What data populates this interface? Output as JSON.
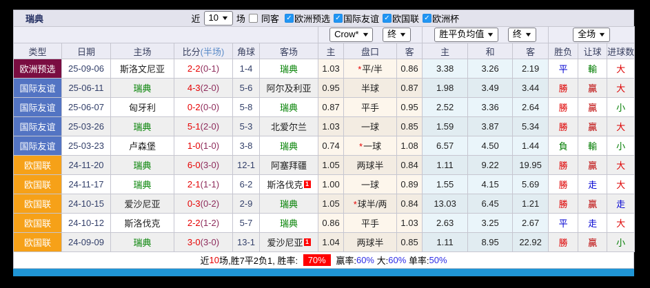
{
  "toolbar": {
    "team": "瑞典",
    "recent_label": "近",
    "recent_value": "10",
    "matches_label": "场",
    "same_away": {
      "label": "同客",
      "checked": false
    },
    "filters": [
      {
        "label": "欧洲预选",
        "checked": true
      },
      {
        "label": "国际友谊",
        "checked": true
      },
      {
        "label": "欧国联",
        "checked": true
      },
      {
        "label": "欧洲杯",
        "checked": true
      }
    ]
  },
  "selectors": {
    "bookmaker": "Crow*",
    "odds_final": "终",
    "avg_label": "胜平负均值",
    "avg_final": "终",
    "scope": "全场"
  },
  "columns": [
    "类型",
    "日期",
    "主场",
    "比分",
    "角球",
    "客场",
    "主",
    "盘口",
    "客",
    "主",
    "和",
    "客",
    "胜负",
    "让球",
    "进球数"
  ],
  "score_half_label": "(半场)",
  "rows": [
    {
      "type": "欧洲预选",
      "type_bg": "type_qual",
      "date": "25-09-06",
      "home": "斯洛文尼亚",
      "home_color": "",
      "home_sup": "",
      "score_ft": "2-2",
      "score_ht": "(0-1)",
      "corners": "1-4",
      "away": "瑞典",
      "away_color": "team_green",
      "away_sup": "",
      "odds_home": "1.03",
      "handicap_star": "*",
      "handicap": "平/半",
      "odds_away": "0.86",
      "avg_home": "3.38",
      "avg_draw": "3.26",
      "avg_away": "2.19",
      "result": "平",
      "result_color": "blue",
      "handicap_result": "輸",
      "handicap_result_color": "green",
      "goals": "大",
      "goals_color": "red"
    },
    {
      "type": "国际友谊",
      "type_bg": "type_friendly",
      "date": "25-06-11",
      "home": "瑞典",
      "home_color": "team_green",
      "home_sup": "",
      "score_ft": "4-3",
      "score_ht": "(2-0)",
      "corners": "5-6",
      "away": "阿尔及利亚",
      "away_color": "",
      "away_sup": "",
      "odds_home": "0.95",
      "handicap_star": "",
      "handicap": "半球",
      "odds_away": "0.87",
      "avg_home": "1.98",
      "avg_draw": "3.49",
      "avg_away": "3.44",
      "result": "勝",
      "result_color": "red",
      "handicap_result": "贏",
      "handicap_result_color": "dark_red",
      "goals": "大",
      "goals_color": "red"
    },
    {
      "type": "国际友谊",
      "type_bg": "type_friendly",
      "date": "25-06-07",
      "home": "匈牙利",
      "home_color": "",
      "home_sup": "",
      "score_ft": "0-2",
      "score_ht": "(0-0)",
      "corners": "5-8",
      "away": "瑞典",
      "away_color": "team_green",
      "away_sup": "",
      "odds_home": "0.87",
      "handicap_star": "",
      "handicap": "平手",
      "odds_away": "0.95",
      "avg_home": "2.52",
      "avg_draw": "3.36",
      "avg_away": "2.64",
      "result": "勝",
      "result_color": "red",
      "handicap_result": "贏",
      "handicap_result_color": "dark_red",
      "goals": "小",
      "goals_color": "green"
    },
    {
      "type": "国际友谊",
      "type_bg": "type_friendly",
      "date": "25-03-26",
      "home": "瑞典",
      "home_color": "team_green",
      "home_sup": "",
      "score_ft": "5-1",
      "score_ht": "(2-0)",
      "corners": "5-3",
      "away": "北爱尔兰",
      "away_color": "",
      "away_sup": "",
      "odds_home": "1.03",
      "handicap_star": "",
      "handicap": "一球",
      "odds_away": "0.85",
      "avg_home": "1.59",
      "avg_draw": "3.87",
      "avg_away": "5.34",
      "result": "勝",
      "result_color": "red",
      "handicap_result": "贏",
      "handicap_result_color": "dark_red",
      "goals": "大",
      "goals_color": "red"
    },
    {
      "type": "国际友谊",
      "type_bg": "type_friendly",
      "date": "25-03-23",
      "home": "卢森堡",
      "home_color": "",
      "home_sup": "",
      "score_ft": "1-0",
      "score_ht": "(1-0)",
      "corners": "3-8",
      "away": "瑞典",
      "away_color": "team_green",
      "away_sup": "",
      "odds_home": "0.74",
      "handicap_star": "*",
      "handicap": "一球",
      "odds_away": "1.08",
      "avg_home": "6.57",
      "avg_draw": "4.50",
      "avg_away": "1.44",
      "result": "負",
      "result_color": "green",
      "handicap_result": "輸",
      "handicap_result_color": "green",
      "goals": "小",
      "goals_color": "green"
    },
    {
      "type": "欧国联",
      "type_bg": "type_nations",
      "date": "24-11-20",
      "home": "瑞典",
      "home_color": "team_green",
      "home_sup": "",
      "score_ft": "6-0",
      "score_ht": "(3-0)",
      "corners": "12-1",
      "away": "阿塞拜疆",
      "away_color": "",
      "away_sup": "",
      "odds_home": "1.05",
      "handicap_star": "",
      "handicap": "两球半",
      "odds_away": "0.84",
      "avg_home": "1.11",
      "avg_draw": "9.22",
      "avg_away": "19.95",
      "result": "勝",
      "result_color": "red",
      "handicap_result": "贏",
      "handicap_result_color": "dark_red",
      "goals": "大",
      "goals_color": "red"
    },
    {
      "type": "欧国联",
      "type_bg": "type_nations",
      "date": "24-11-17",
      "home": "瑞典",
      "home_color": "team_green",
      "home_sup": "",
      "score_ft": "2-1",
      "score_ht": "(1-1)",
      "corners": "6-2",
      "away": "斯洛伐克",
      "away_color": "",
      "away_sup": "1",
      "odds_home": "1.00",
      "handicap_star": "",
      "handicap": "一球",
      "odds_away": "0.89",
      "avg_home": "1.55",
      "avg_draw": "4.15",
      "avg_away": "5.69",
      "result": "勝",
      "result_color": "red",
      "handicap_result": "走",
      "handicap_result_color": "blue",
      "goals": "大",
      "goals_color": "red"
    },
    {
      "type": "欧国联",
      "type_bg": "type_nations",
      "date": "24-10-15",
      "home": "爱沙尼亚",
      "home_color": "",
      "home_sup": "",
      "score_ft": "0-3",
      "score_ht": "(0-2)",
      "corners": "2-9",
      "away": "瑞典",
      "away_color": "team_green",
      "away_sup": "",
      "odds_home": "1.05",
      "handicap_star": "*",
      "handicap": "球半/两",
      "odds_away": "0.84",
      "avg_home": "13.03",
      "avg_draw": "6.45",
      "avg_away": "1.21",
      "result": "勝",
      "result_color": "red",
      "handicap_result": "贏",
      "handicap_result_color": "dark_red",
      "goals": "走",
      "goals_color": "blue"
    },
    {
      "type": "欧国联",
      "type_bg": "type_nations",
      "date": "24-10-12",
      "home": "斯洛伐克",
      "home_color": "",
      "home_sup": "",
      "score_ft": "2-2",
      "score_ht": "(1-2)",
      "corners": "5-7",
      "away": "瑞典",
      "away_color": "team_green",
      "away_sup": "",
      "odds_home": "0.86",
      "handicap_star": "",
      "handicap": "平手",
      "odds_away": "1.03",
      "avg_home": "2.63",
      "avg_draw": "3.25",
      "avg_away": "2.67",
      "result": "平",
      "result_color": "blue",
      "handicap_result": "走",
      "handicap_result_color": "blue",
      "goals": "大",
      "goals_color": "red"
    },
    {
      "type": "欧国联",
      "type_bg": "type_nations",
      "date": "24-09-09",
      "home": "瑞典",
      "home_color": "team_green",
      "home_sup": "",
      "score_ft": "3-0",
      "score_ht": "(3-0)",
      "corners": "13-1",
      "away": "爱沙尼亚",
      "away_color": "",
      "away_sup": "1",
      "odds_home": "1.04",
      "handicap_star": "",
      "handicap": "两球半",
      "odds_away": "0.85",
      "avg_home": "1.11",
      "avg_draw": "8.95",
      "avg_away": "22.92",
      "result": "勝",
      "result_color": "red",
      "handicap_result": "贏",
      "handicap_result_color": "dark_red",
      "goals": "小",
      "goals_color": "green"
    }
  ],
  "summary": {
    "segments": [
      {
        "text": "近",
        "style": "plain"
      },
      {
        "text": "10",
        "style": "red"
      },
      {
        "text": "场,胜7平2负1, 胜率: ",
        "style": "plain"
      },
      {
        "text": "70%",
        "style": "badge"
      },
      {
        "text": " 赢率:",
        "style": "plain"
      },
      {
        "text": "60%",
        "style": "blue"
      },
      {
        "text": " 大:",
        "style": "plain"
      },
      {
        "text": "60%",
        "style": "blue"
      },
      {
        "text": " 单率:",
        "style": "plain"
      },
      {
        "text": "50%",
        "style": "blue"
      }
    ]
  },
  "colors": {
    "red": "#DE0000",
    "dark_red": "#BC0000",
    "green": "#007C00",
    "blue": "#0000D2",
    "team_green": "#008000",
    "score_ft": "#E60000",
    "score_ht": "#8D2B5B",
    "type_qual": "#7A0D41",
    "type_friendly": "#5374C3",
    "type_nations": "#F6A118",
    "badge_red": "#FF0000",
    "percent_blue": "#2B2BE6",
    "accent_bar": "#2095D5",
    "checkbox_checked": "#2196F3",
    "check_glyph": "✓"
  }
}
